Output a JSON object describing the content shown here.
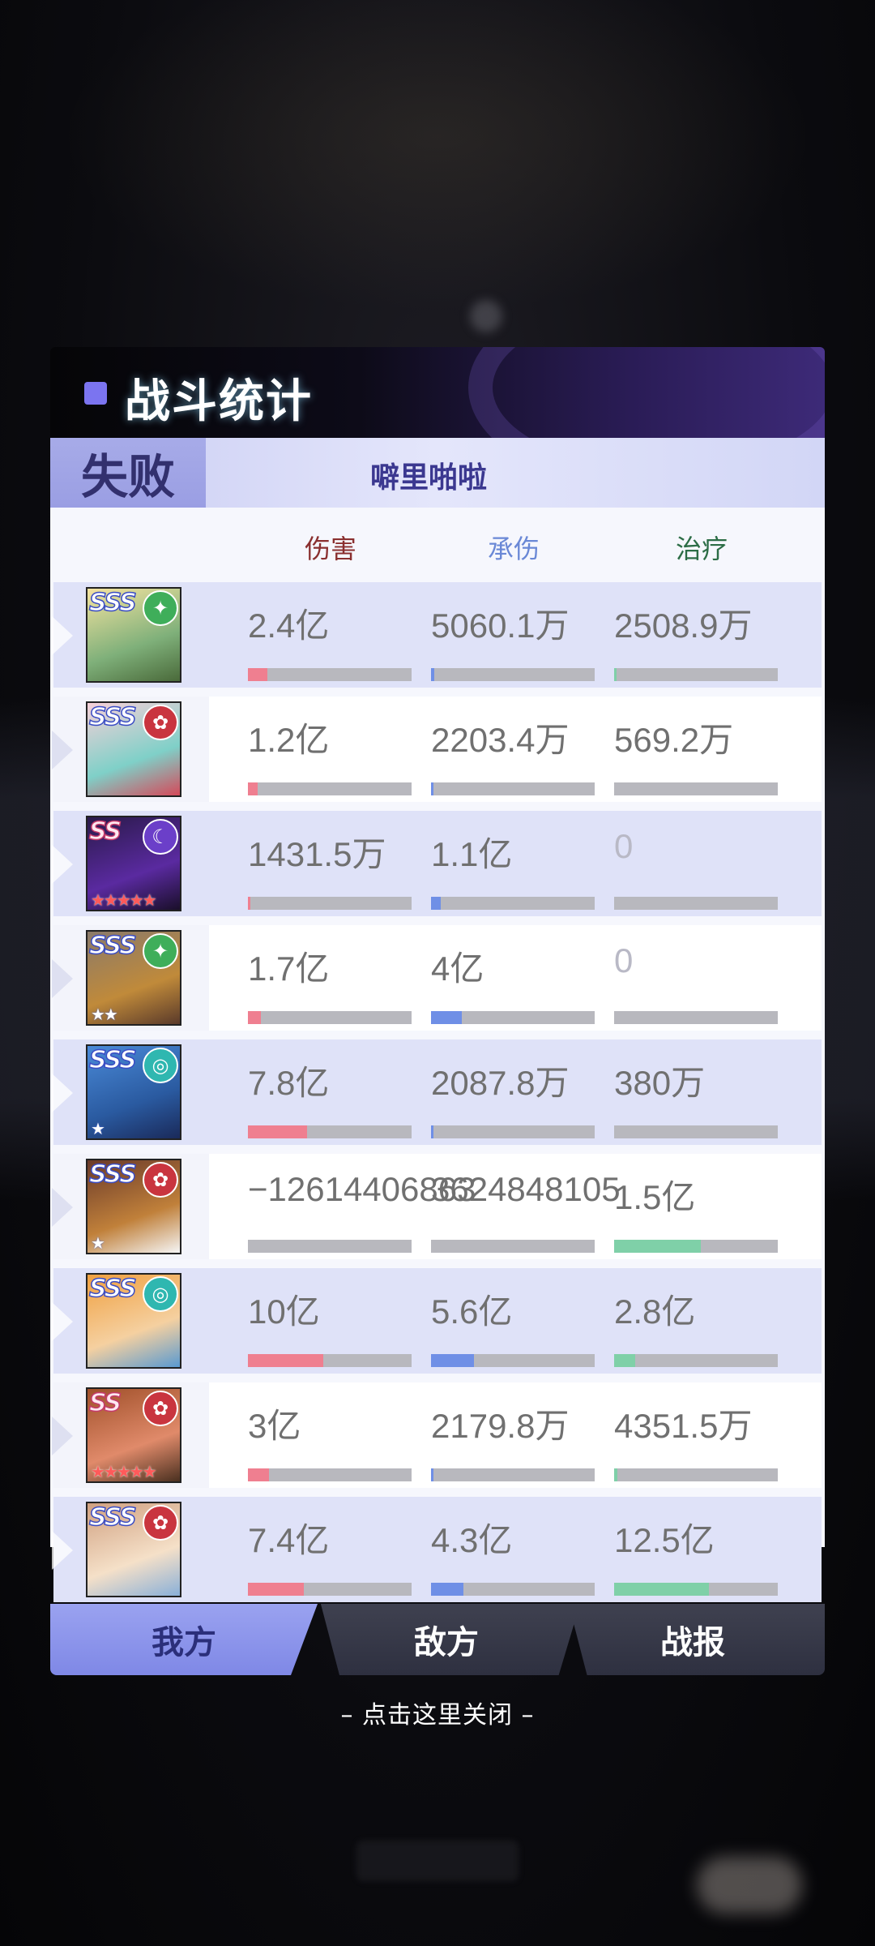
{
  "header": {
    "title": "战斗统计"
  },
  "result": {
    "status": "失败",
    "player": "噼里啪啦"
  },
  "columns": {
    "damage": "伤害",
    "taken": "承伤",
    "heal": "治疗"
  },
  "rows": [
    {
      "grade": "SSS",
      "element": "grass",
      "damage": "2.4亿",
      "taken": "5060.1万",
      "heal": "2508.9万",
      "damage_pct": 0.12,
      "taken_pct": 0.02,
      "heal_pct": 0.01
    },
    {
      "grade": "SSS",
      "element": "fire",
      "damage": "1.2亿",
      "taken": "2203.4万",
      "heal": "569.2万",
      "damage_pct": 0.06,
      "taken_pct": 0.01,
      "heal_pct": 0.0
    },
    {
      "grade": "SS",
      "element": "dark",
      "damage": "1431.5万",
      "taken": "1.1亿",
      "heal": "0",
      "damage_pct": 0.01,
      "taken_pct": 0.06,
      "heal_pct": 0.0
    },
    {
      "grade": "SSS",
      "element": "grass",
      "damage": "1.7亿",
      "taken": "4亿",
      "heal": "0",
      "damage_pct": 0.08,
      "taken_pct": 0.19,
      "heal_pct": 0.0
    },
    {
      "grade": "SSS",
      "element": "water",
      "damage": "7.8亿",
      "taken": "2087.8万",
      "heal": "380万",
      "damage_pct": 0.36,
      "taken_pct": 0.01,
      "heal_pct": 0.0
    },
    {
      "grade": "SSS",
      "element": "fire",
      "damage": "−12614406863",
      "taken": "3624848105",
      "heal": "1.5亿",
      "damage_pct": 0.0,
      "taken_pct": 0.0,
      "heal_pct": 0.53
    },
    {
      "grade": "SSS",
      "element": "water",
      "damage": "10亿",
      "taken": "5.6亿",
      "heal": "2.8亿",
      "damage_pct": 0.46,
      "taken_pct": 0.26,
      "heal_pct": 0.13
    },
    {
      "grade": "SS",
      "element": "fire",
      "damage": "3亿",
      "taken": "2179.8万",
      "heal": "4351.5万",
      "damage_pct": 0.13,
      "taken_pct": 0.01,
      "heal_pct": 0.02
    },
    {
      "grade": "SSS",
      "element": "fire",
      "damage": "7.4亿",
      "taken": "4.3亿",
      "heal": "12.5亿",
      "damage_pct": 0.34,
      "taken_pct": 0.2,
      "heal_pct": 0.58
    }
  ],
  "tabs": {
    "mine": "我方",
    "enemy": "敌方",
    "report": "战报"
  },
  "close_hint": "– 点击这里关闭 –",
  "colors": {
    "damage": "#ef7f90",
    "taken": "#6f8fe6",
    "heal": "#7fd0a8",
    "accent": "#7b74f0"
  }
}
